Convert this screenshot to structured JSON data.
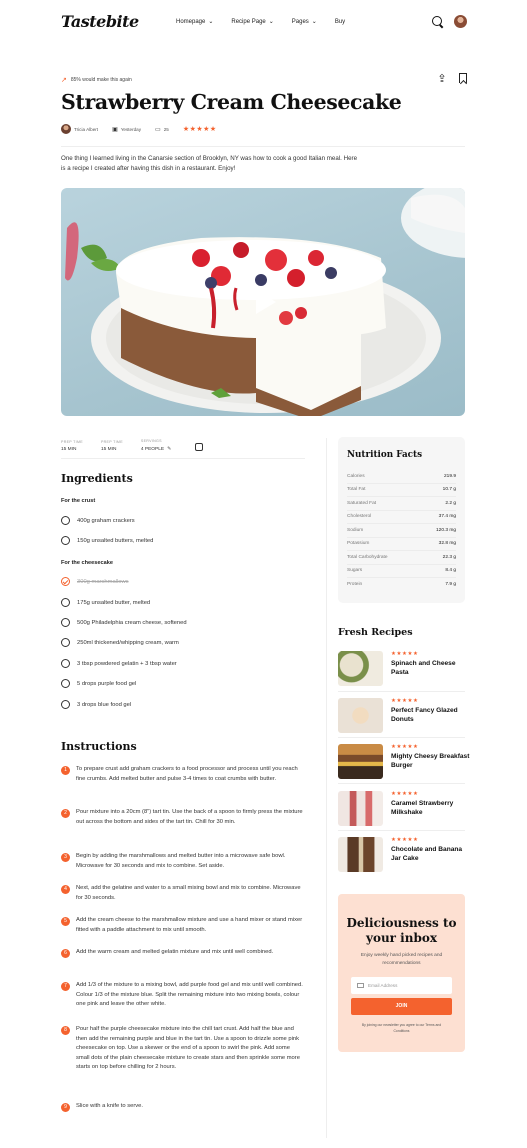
{
  "header": {
    "logo": "Tastebite",
    "nav": [
      "Homepage",
      "Recipe Page",
      "Pages",
      "Buy"
    ]
  },
  "recipe": {
    "rating_note": "85% would make this again",
    "title": "Strawberry Cream Cheesecake",
    "author": "Tricia Albert",
    "date": "Yesterday",
    "comments": "25",
    "stars": "★★★★★",
    "intro": "One thing I learned living in the Canarsie section of Brooklyn, NY was how to cook a good Italian meal. Here is a recipe I created after having this dish in a restaurant. Enjoy!"
  },
  "info": {
    "prep_label": "PREP TIME",
    "prep_value": "15 MIN",
    "cook_label": "PREP TIME",
    "cook_value": "15 MIN",
    "serv_label": "SERVINGS",
    "serv_value": "4 PEOPLE"
  },
  "ingredients": {
    "heading": "Ingredients",
    "crust_title": "For the crust",
    "crust": [
      "400g graham crackers",
      "150g unsalted butters, melted"
    ],
    "cake_title": "For the cheesecake",
    "cake": [
      "300g marshmallows",
      "175g unsalted butter, melted",
      "500g Philadelphia cream cheese, softened",
      "250ml thickened/whipping cream, warm",
      "3 tbsp powdered gelatin + 3 tbsp water",
      "5 drops purple food gel",
      "3 drops blue food gel"
    ]
  },
  "instructions": {
    "heading": "Instructions",
    "steps": [
      "To prepare crust add graham crackers to a food processor and process until you reach fine crumbs. Add melted butter and pulse 3-4 times to coat crumbs with butter.",
      "Pour mixture into a 20cm (8\") tart tin. Use the back of a spoon to firmly press the mixture out across the bottom and sides of the tart tin. Chill for 30 min.",
      "Begin by adding the marshmallows and melted butter into a microwave safe bowl. Microwave for 30 seconds and mix to combine. Set aside.",
      "Next, add the gelatine and water to a small mixing bowl and mix to combine. Microwave for 30 seconds.",
      "Add the cream cheese to the marshmallow mixture and use a hand mixer or stand mixer fitted with a paddle attachment to mix until smooth.",
      "Add the warm cream and melted gelatin mixture and mix until well combined.",
      "Add 1/3 of the mixture to a mixing bowl, add purple food gel and mix until well combined. Colour 1/3 of the mixture blue. Split the remaining mixture into two mixing bowls, colour one pink and leave the other white.",
      "Pour half the purple cheesecake mixture into the chill tart crust. Add half the blue and then add the remaining purple and blue in the tart tin. Use a spoon to drizzle some pink cheesecake on top. Use a skewer or the end of a spoon to swirl the pink. Add some small dots of the plain cheesecake mixture to create stars and then sprinkle some more starts on top before chilling for 2 hours.",
      "Slice with a knife to serve."
    ]
  },
  "nutrition": {
    "heading": "Nutrition Facts",
    "rows": [
      {
        "k": "Calories",
        "v": "219.9"
      },
      {
        "k": "Total Fat",
        "v": "10.7 g"
      },
      {
        "k": "Saturated Fat",
        "v": "2.2 g"
      },
      {
        "k": "Cholesterol",
        "v": "37.4 mg"
      },
      {
        "k": "Sodium",
        "v": "120.3 mg"
      },
      {
        "k": "Potassium",
        "v": "32.8 mg"
      },
      {
        "k": "Total Carbohydrate",
        "v": "22.3 g"
      },
      {
        "k": "Sugars",
        "v": "8.4 g"
      },
      {
        "k": "Protein",
        "v": "7.9 g"
      }
    ]
  },
  "fresh": {
    "heading": "Fresh Recipes",
    "stars": "★★★★★",
    "items": [
      "Spinach and Cheese Pasta",
      "Perfect Fancy Glazed Donuts",
      "Mighty Cheesy Breakfast Burger",
      "Caramel Strawberry Milkshake",
      "Chocolate and Banana Jar Cake"
    ]
  },
  "newsletter": {
    "title": "Deliciousness to your inbox",
    "sub": "Enjoy weekly hand picked recipes and recommendations",
    "placeholder": "Email Address",
    "button": "JOIN",
    "legal": "By joining our newsletter you agree to our Terms and Conditions"
  },
  "colors": {
    "accent": "#f4622e",
    "promo_bg": "#fde0d2"
  }
}
